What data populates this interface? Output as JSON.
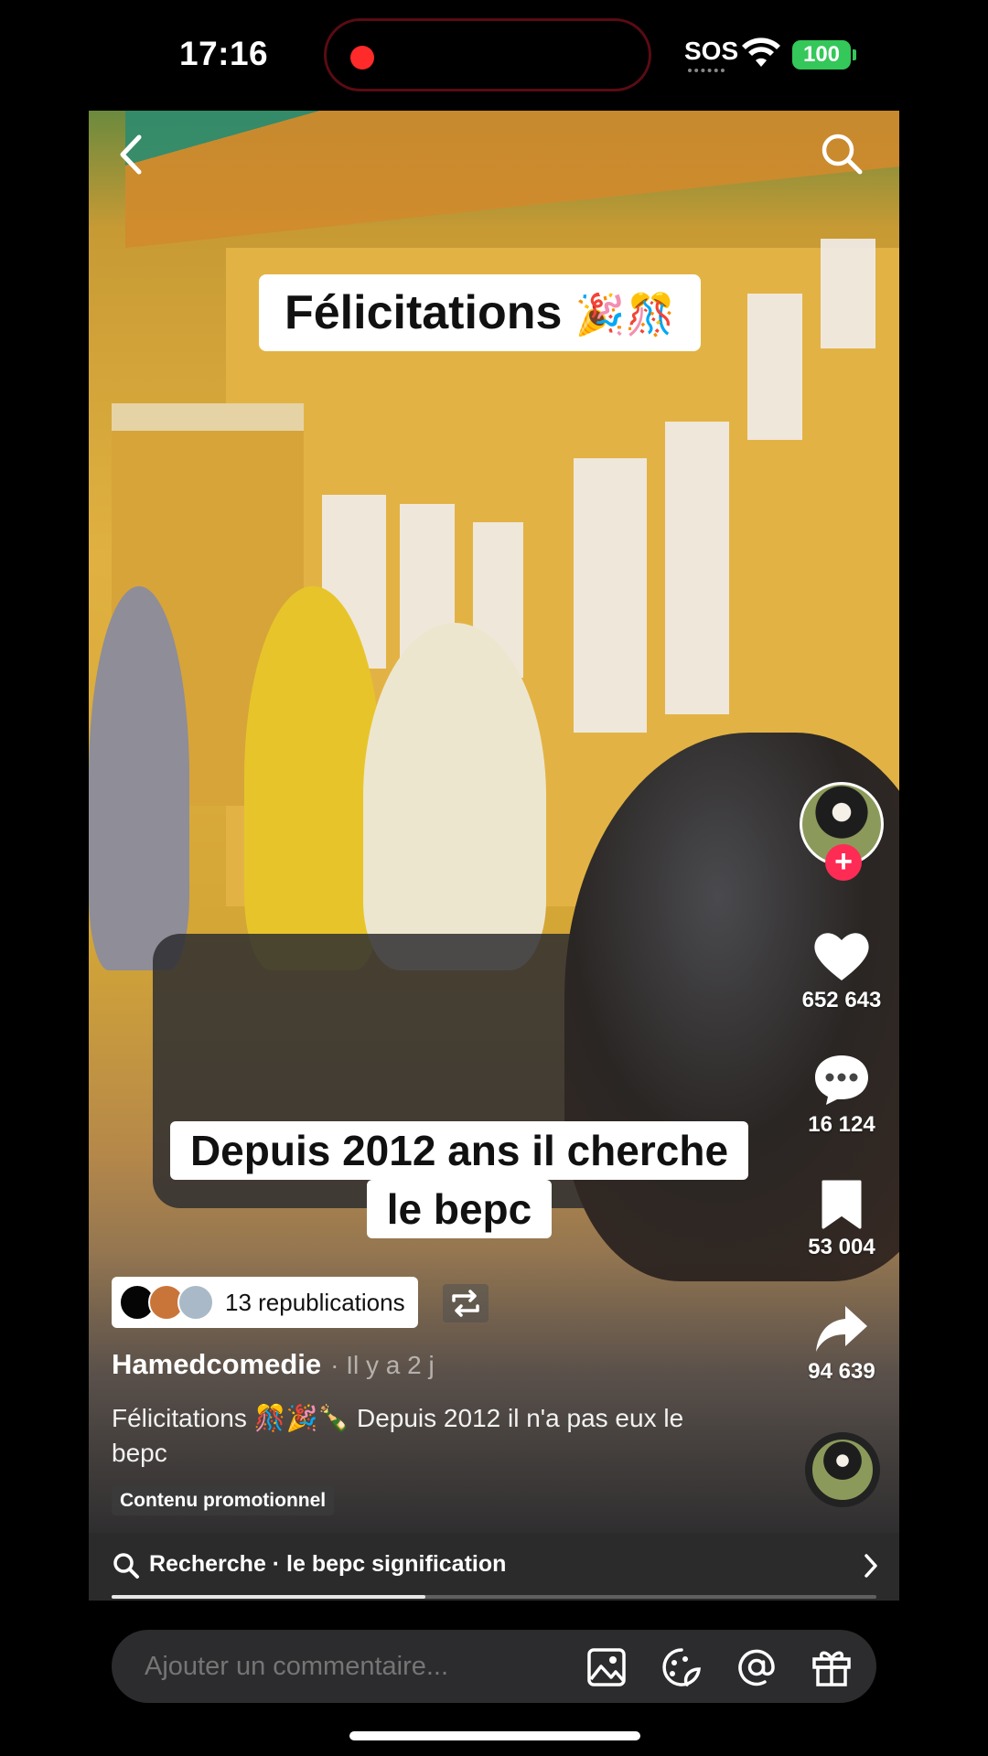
{
  "status_bar": {
    "time": "17:16",
    "sos_label": "SOS",
    "battery": "100"
  },
  "video": {
    "caption_top": "Félicitations",
    "caption_top_emoji": "🎉🎊",
    "caption_mid_line1": "Depuis 2012 ans il cherche",
    "caption_mid_line2": "le bepc"
  },
  "rail": {
    "likes": "652 643",
    "comments": "16 124",
    "saves": "53 004",
    "shares": "94 639"
  },
  "post": {
    "repost_count_label": "13 republications",
    "author": "Hamedcomedie",
    "time_ago": "· Il y a 2 j",
    "description_start": "Félicitations ",
    "description_emoji": "🎊🎉🍾",
    "description_rest": " Depuis 2012 il n'a pas eux le bepc",
    "promo_label": "Contenu promotionnel"
  },
  "search_suggestion": {
    "text": "Recherche · le bepc signification"
  },
  "playback": {
    "progress": 0.41
  },
  "comment_bar": {
    "placeholder": "Ajouter un commentaire..."
  },
  "colors": {
    "follow": "#fe2c55",
    "battery": "#34c759",
    "recording": "#ff2a2a"
  },
  "icons": [
    "back-icon",
    "search-icon",
    "heart-icon",
    "comment-icon",
    "bookmark-icon",
    "share-icon",
    "repost-icon",
    "image-icon",
    "sticker-icon",
    "mention-icon",
    "gift-icon",
    "chevron-right-icon",
    "wifi-icon"
  ]
}
